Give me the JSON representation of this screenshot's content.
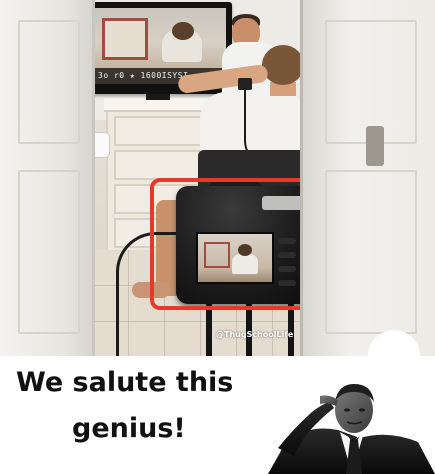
{
  "photo": {
    "tv_osd": "3o r0  ★ 1600ISYSI",
    "watermark": "@ThugSchoolLife",
    "highlight_color": "#e53a2a"
  },
  "caption": {
    "line1": "We salute this",
    "line2": "genius!"
  },
  "figure": {
    "icon": "saluting-man-illustration"
  }
}
